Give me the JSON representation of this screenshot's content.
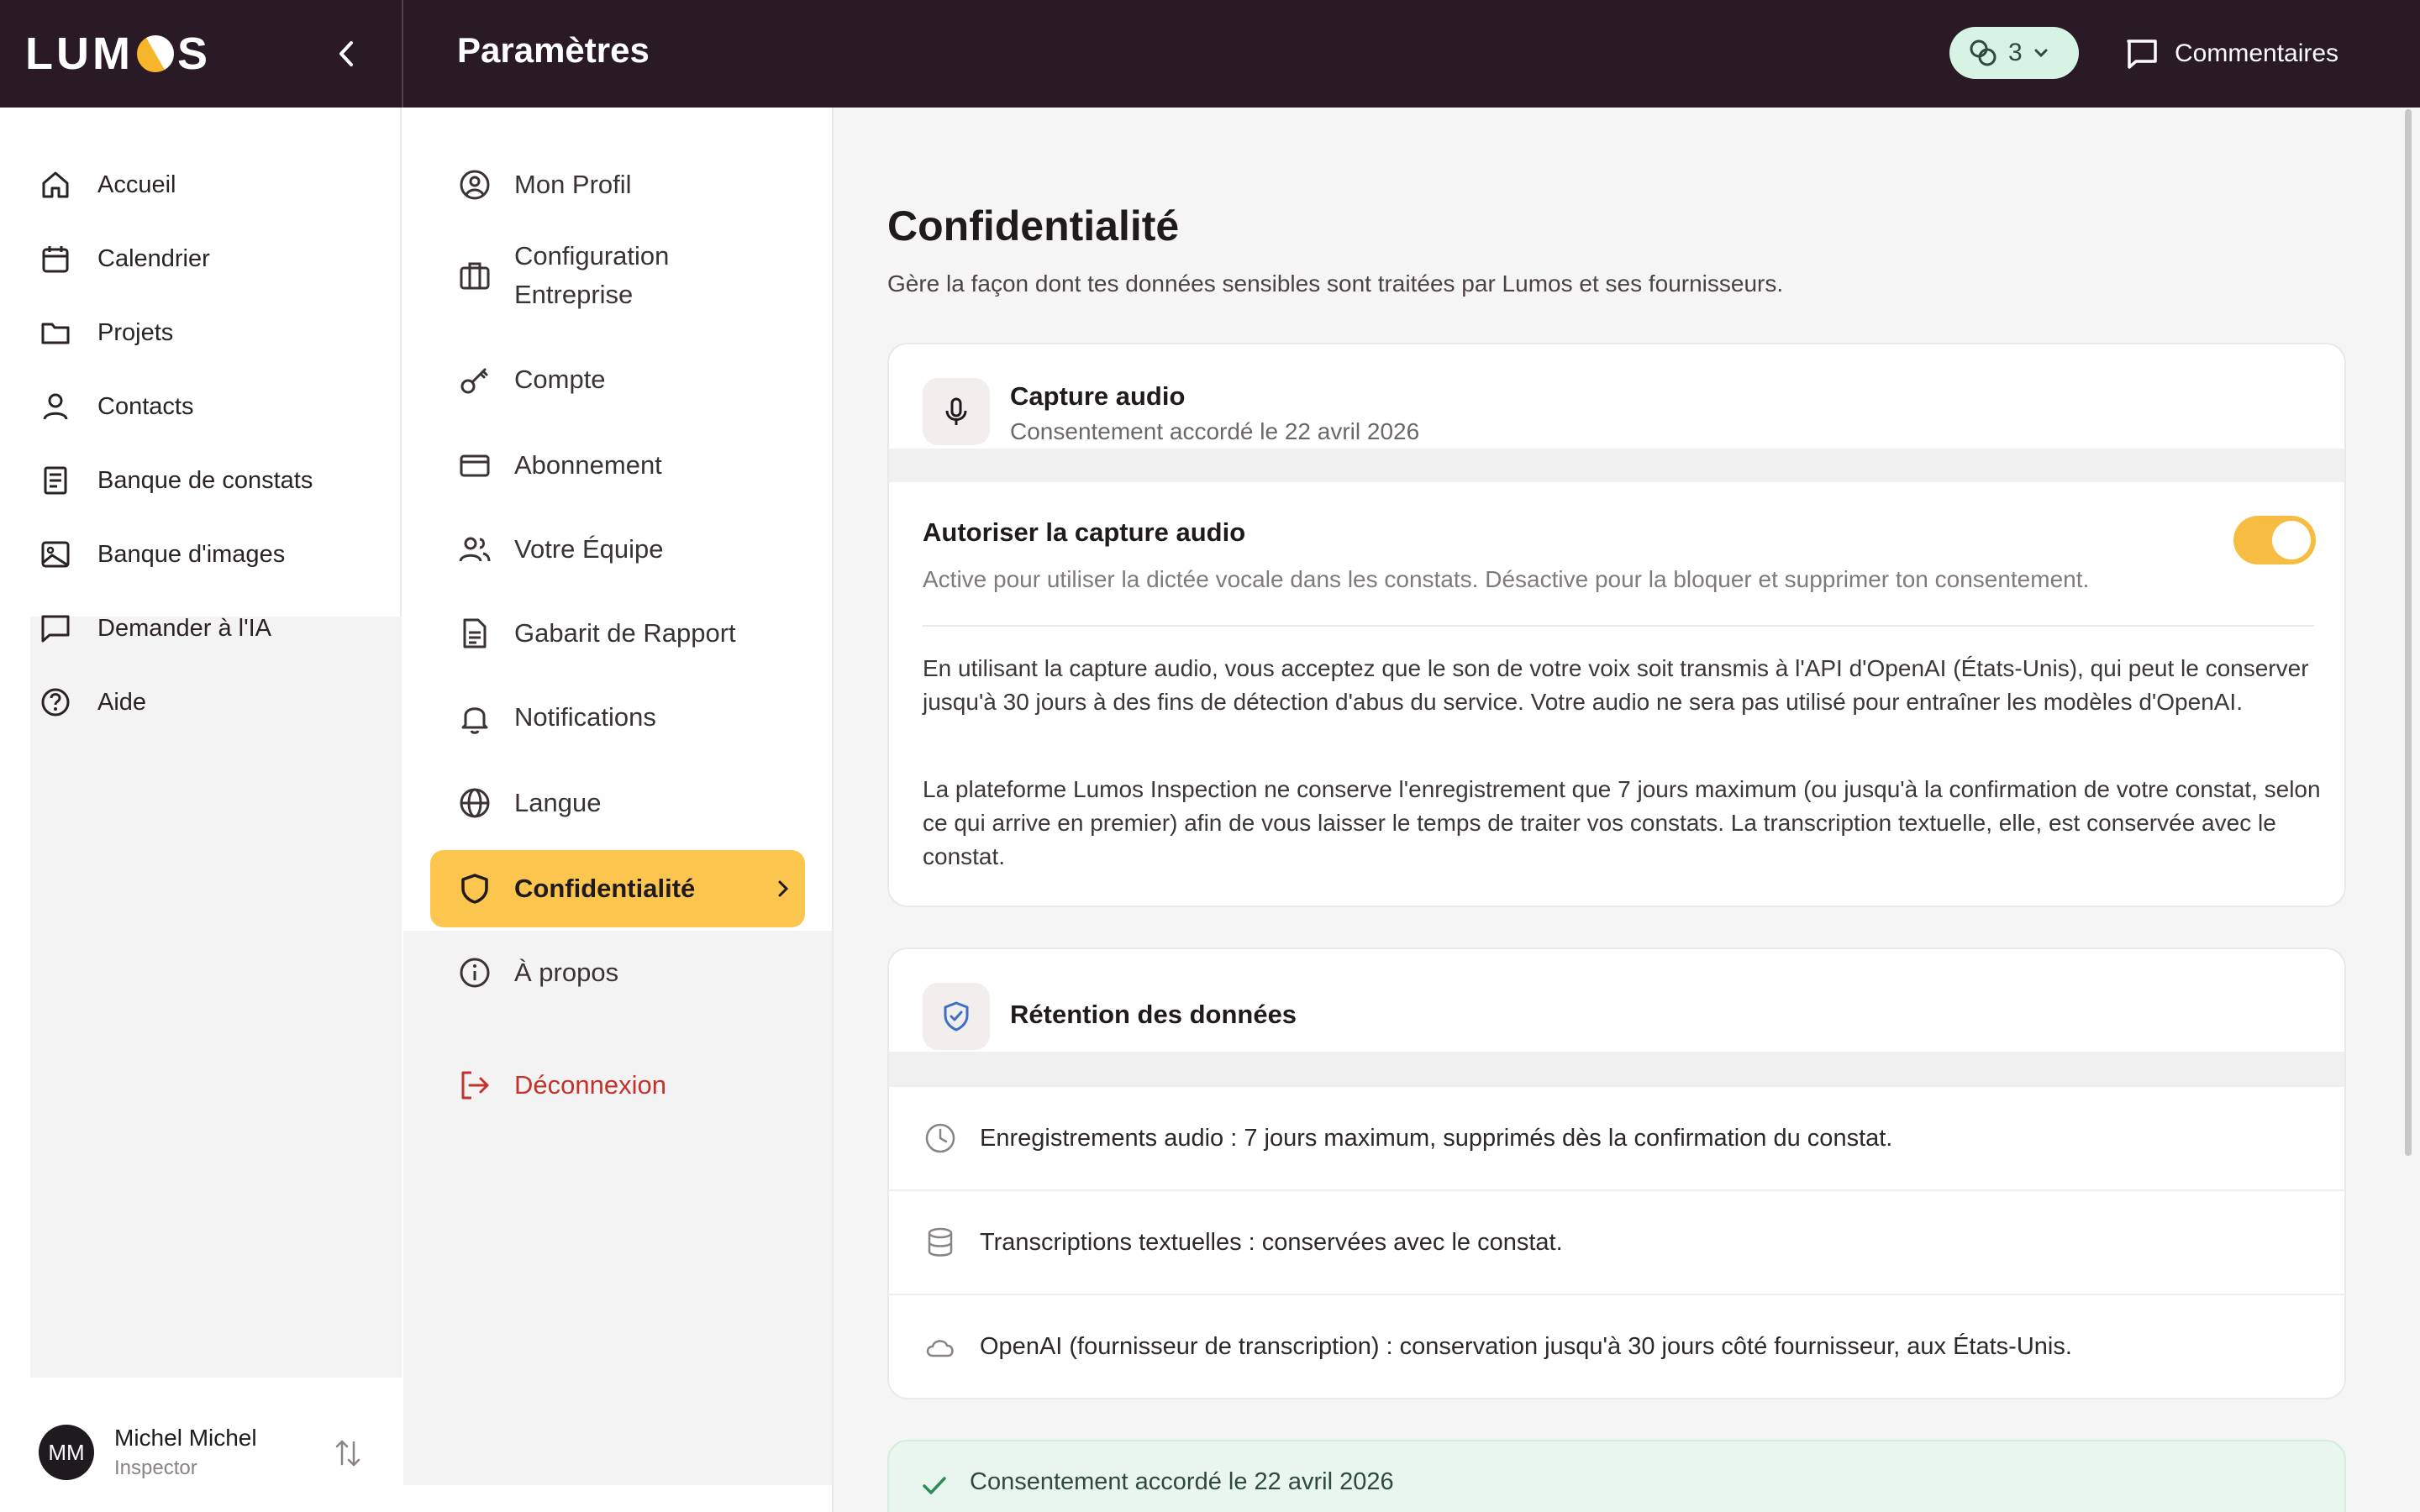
{
  "app": {
    "logo_text": "LUMOS"
  },
  "header": {
    "title": "Paramètres",
    "credits_count": "3",
    "feedback_label": "Commentaires"
  },
  "sidebar": {
    "items": [
      {
        "label": "Accueil",
        "icon": "home-icon"
      },
      {
        "label": "Calendrier",
        "icon": "calendar-icon"
      },
      {
        "label": "Projets",
        "icon": "folder-icon"
      },
      {
        "label": "Contacts",
        "icon": "user-icon"
      },
      {
        "label": "Banque de constats",
        "icon": "document-list-icon"
      },
      {
        "label": "Banque d'images",
        "icon": "image-icon"
      },
      {
        "label": "Demander à l'IA",
        "icon": "chat-icon"
      },
      {
        "label": "Aide",
        "icon": "help-icon"
      }
    ],
    "user": {
      "initials": "MM",
      "name": "Michel Michel",
      "role": "Inspector"
    }
  },
  "settings_nav": {
    "items": [
      {
        "label": "Mon Profil"
      },
      {
        "label": "Configuration Entreprise"
      },
      {
        "label": "Compte"
      },
      {
        "label": "Abonnement"
      },
      {
        "label": "Votre Équipe"
      },
      {
        "label": "Gabarit de Rapport"
      },
      {
        "label": "Notifications"
      },
      {
        "label": "Langue"
      },
      {
        "label": "Confidentialité",
        "active": true
      },
      {
        "label": "À propos"
      }
    ],
    "logout_label": "Déconnexion"
  },
  "main": {
    "title": "Confidentialité",
    "subtitle": "Gère la façon dont tes données sensibles sont traitées par Lumos et ses fournisseurs.",
    "audio_card": {
      "title": "Capture audio",
      "consent_text": "Consentement accordé le 22 avril 2026",
      "toggle_label": "Autoriser la capture audio",
      "toggle_on": true,
      "toggle_description": "Active pour utiliser la dictée vocale dans les constats. Désactive pour la bloquer et supprimer ton consentement.",
      "paragraph_1": "En utilisant la capture audio, vous acceptez que le son de votre voix soit transmis à l'API d'OpenAI (États-Unis), qui peut le conserver jusqu'à 30 jours à des fins de détection d'abus du service. Votre audio ne sera pas utilisé pour entraîner les modèles d'OpenAI.",
      "paragraph_2": "La plateforme Lumos Inspection ne conserve l'enregistrement que 7 jours maximum (ou jusqu'à la confirmation de votre constat, selon ce qui arrive en premier) afin de vous laisser le temps de traiter vos constats. La transcription textuelle, elle, est conservée avec le constat."
    },
    "retention_card": {
      "title": "Rétention des données",
      "rows": [
        {
          "text": "Enregistrements audio : 7 jours maximum, supprimés dès la confirmation du constat.",
          "icon": "clock-icon"
        },
        {
          "text": "Transcriptions textuelles : conservées avec le constat.",
          "icon": "database-icon"
        },
        {
          "text": "OpenAI (fournisseur de transcription) : conservation jusqu'à 30 jours côté fournisseur, aux États-Unis.",
          "icon": "cloud-icon"
        }
      ]
    },
    "consent_banner": "Consentement accordé le 22 avril 2026"
  },
  "colors": {
    "topbar": "#2a1a26",
    "accent": "#fbc54e",
    "toggle": "#f7bd42",
    "success_bg": "#e9f6ee",
    "danger": "#c2332d"
  }
}
